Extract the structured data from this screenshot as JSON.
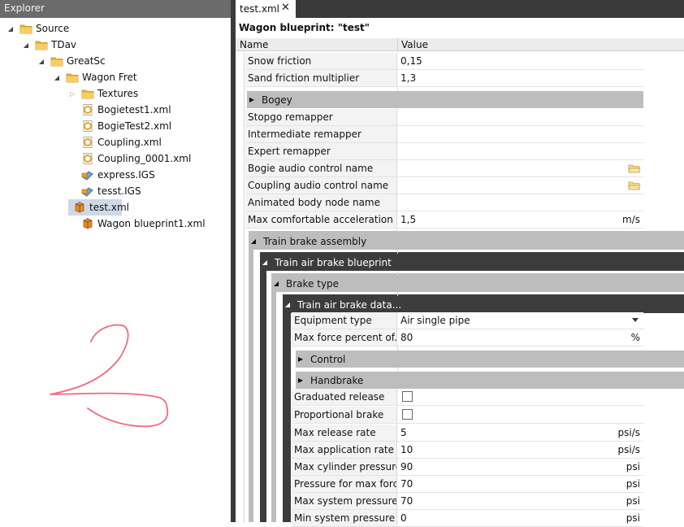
{
  "explorer": {
    "title": "Explorer",
    "tree": [
      {
        "label": "Source",
        "type": "folder",
        "expanded": true
      },
      {
        "label": "TDav",
        "type": "folder",
        "expanded": true
      },
      {
        "label": "GreatSc",
        "type": "folder",
        "expanded": true
      },
      {
        "label": "Wagon Fret",
        "type": "folder",
        "expanded": true
      },
      {
        "label": "Textures",
        "type": "folder",
        "expanded": false
      },
      {
        "label": "Bogietest1.xml",
        "type": "bogie-xml"
      },
      {
        "label": "BogieTest2.xml",
        "type": "bogie-xml"
      },
      {
        "label": "Coupling.xml",
        "type": "bogie-xml"
      },
      {
        "label": "Coupling_0001.xml",
        "type": "bogie-xml"
      },
      {
        "label": "express.IGS",
        "type": "igs"
      },
      {
        "label": "tesst.IGS",
        "type": "igs"
      },
      {
        "label": "test.xml",
        "type": "wagon-xml",
        "selected": true
      },
      {
        "label": "Wagon blueprint1.xml",
        "type": "wagon-xml"
      }
    ]
  },
  "document": {
    "tab_label": "test.xml",
    "tab_close": "✕",
    "title": "Wagon blueprint: \"test\"",
    "columns": {
      "name": "Name",
      "value": "Value"
    },
    "top_rows": [
      {
        "name": "Snow friction",
        "value": "0,15",
        "unit": ""
      },
      {
        "name": "Sand friction multiplier",
        "value": "1,3",
        "unit": ""
      }
    ],
    "bogey_group": "Bogey",
    "mid_rows": [
      {
        "name": "Stopgo remapper",
        "value": "",
        "unit": "",
        "browse": false
      },
      {
        "name": "Intermediate remapper",
        "value": "",
        "unit": "",
        "browse": false
      },
      {
        "name": "Expert remapper",
        "value": "",
        "unit": "",
        "browse": false
      },
      {
        "name": "Bogie audio control name",
        "value": "",
        "unit": "",
        "browse": true
      },
      {
        "name": "Coupling audio control name",
        "value": "",
        "unit": "",
        "browse": true
      },
      {
        "name": "Animated body node name",
        "value": "",
        "unit": "",
        "browse": false
      },
      {
        "name": "Max comfortable acceleration",
        "value": "1,5",
        "unit": "m/s",
        "browse": false
      }
    ],
    "groups": {
      "train_brake_assembly": "Train brake assembly",
      "train_air_brake_blueprint": "Train air brake blueprint",
      "brake_type": "Brake type",
      "train_air_brake_data": "Train air brake data...",
      "control": "Control",
      "handbrake": "Handbrake"
    },
    "equipment_rows": [
      {
        "name": "Equipment type",
        "value": "Air single pipe",
        "unit": "",
        "dropdown": true
      },
      {
        "name": "Max force percent of...",
        "value": "80",
        "unit": "%",
        "dropdown": false
      }
    ],
    "check_rows": [
      {
        "name": "Graduated release",
        "checked": false
      },
      {
        "name": "Proportional brake",
        "checked": false
      }
    ],
    "rate_rows": [
      {
        "name": "Max release rate",
        "value": "5",
        "unit": "psi/s"
      },
      {
        "name": "Max application rate",
        "value": "10",
        "unit": "psi/s"
      },
      {
        "name": "Max cylinder pressure",
        "value": "90",
        "unit": "psi"
      },
      {
        "name": "Pressure for max force",
        "value": "70",
        "unit": "psi"
      },
      {
        "name": "Max system pressure",
        "value": "70",
        "unit": "psi"
      },
      {
        "name": "Min system pressure",
        "value": "0",
        "unit": "psi"
      }
    ]
  }
}
